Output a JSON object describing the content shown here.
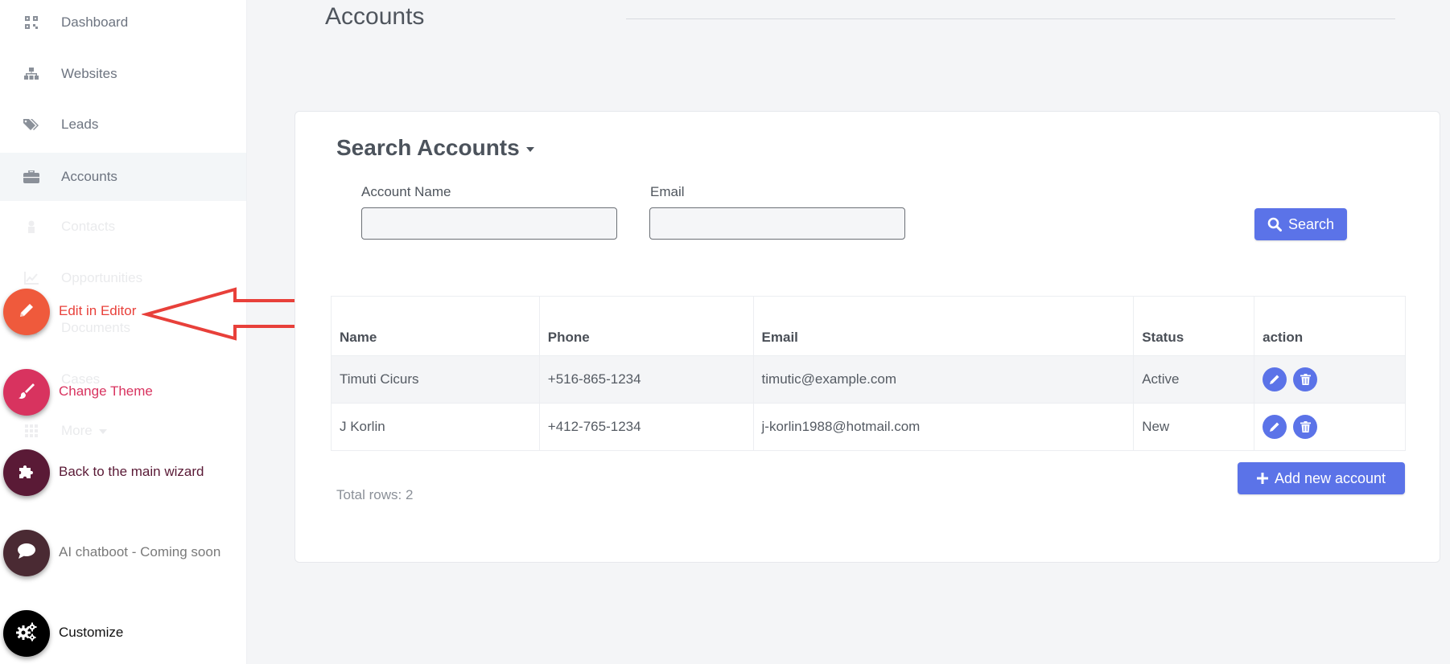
{
  "sidebar": {
    "items": [
      {
        "label": "Dashboard",
        "icon": "qrcode-icon"
      },
      {
        "label": "Websites",
        "icon": "sitemap-icon"
      },
      {
        "label": "Leads",
        "icon": "tags-icon"
      },
      {
        "label": "Accounts",
        "icon": "briefcase-icon",
        "active": true
      },
      {
        "label": "Contacts",
        "icon": "user-icon"
      },
      {
        "label": "Opportunities",
        "icon": "chart-line-icon"
      },
      {
        "label": "Documents",
        "icon": "file-icon"
      },
      {
        "label": "Cases",
        "icon": "folder-icon"
      },
      {
        "label": "More",
        "icon": "grid-icon"
      }
    ]
  },
  "floating_menu": [
    {
      "label": "Edit in Editor",
      "icon": "pencil-icon",
      "color": "#ef5a3c"
    },
    {
      "label": "Change Theme",
      "icon": "brush-icon",
      "color": "#d8335f"
    },
    {
      "label": "Back to the main wizard",
      "icon": "puzzle-icon",
      "color": "#5a1a36"
    },
    {
      "label": "AI chatboot - Coming soon",
      "icon": "chat-icon",
      "color": "#4a2a33"
    },
    {
      "label": "Customize",
      "icon": "gears-icon",
      "color": "#000000"
    }
  ],
  "page": {
    "title": "Accounts"
  },
  "search": {
    "title": "Search Accounts",
    "account_name_label": "Account Name",
    "account_name_value": "",
    "email_label": "Email",
    "email_value": "",
    "search_button": "Search"
  },
  "table": {
    "headers": [
      "Name",
      "Phone",
      "Email",
      "Status",
      "action"
    ],
    "rows": [
      {
        "name": "Timuti Cicurs",
        "phone": "+516-865-1234",
        "email": "timutic@example.com",
        "status": "Active"
      },
      {
        "name": "J Korlin",
        "phone": "+412-765-1234",
        "email": "j-korlin1988@hotmail.com",
        "status": "New"
      }
    ]
  },
  "add_button": "Add new account",
  "total_rows": "Total rows: 2",
  "colors": {
    "accent": "#5b73e8",
    "annotation_arrow": "#e8403a"
  }
}
